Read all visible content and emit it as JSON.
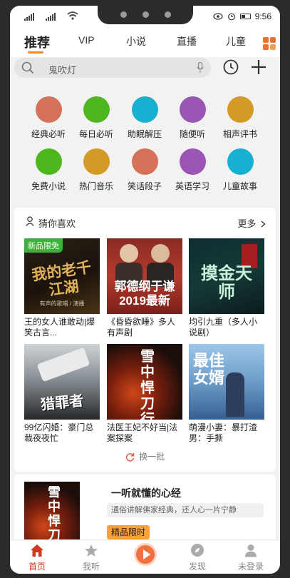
{
  "status": {
    "time": "9:56"
  },
  "tabs": [
    {
      "label": "推荐"
    },
    {
      "label": "VIP"
    },
    {
      "label": "小说"
    },
    {
      "label": "直播"
    },
    {
      "label": "儿童"
    }
  ],
  "search": {
    "placeholder": "鬼吹灯"
  },
  "categories": [
    {
      "label": "经典必听",
      "color": "#d6725a"
    },
    {
      "label": "每日必听",
      "color": "#4db81e"
    },
    {
      "label": "助眠解压",
      "color": "#17b0d0"
    },
    {
      "label": "随便听",
      "color": "#9a55b5"
    },
    {
      "label": "相声评书",
      "color": "#d49a25"
    },
    {
      "label": "免费小说",
      "color": "#4db81e"
    },
    {
      "label": "热门音乐",
      "color": "#d49a25"
    },
    {
      "label": "笑话段子",
      "color": "#d6725a"
    },
    {
      "label": "英语学习",
      "color": "#9a55b5"
    },
    {
      "label": "儿童故事",
      "color": "#17b0d0"
    }
  ],
  "recommend": {
    "title": "猜你喜欢",
    "more": "更多",
    "refresh": "换一批",
    "books": [
      {
        "title": "王的女人谁敢动|爆笑古言...",
        "badge": "新品限免",
        "cover_text": "我的老千江湖",
        "cover_subtext": "有声的歌唱 / 演播"
      },
      {
        "title": "《昏昏欲睡》多人有声剧",
        "cover_text": "郭德纲于谦 2019最新"
      },
      {
        "title": "均引九重（多人小说剧）",
        "cover_text": "摸金天师"
      },
      {
        "title": "99亿闪婚：豪门总裁夜夜忙",
        "cover_text": "猎罪者"
      },
      {
        "title": "法医王妃不好当|法案探案",
        "cover_text": "雪中悍刀行"
      },
      {
        "title": "萌漫小妻：暴打渣男：手撕",
        "cover_text": "最佳女婿"
      }
    ]
  },
  "feature": {
    "title": "一听就懂的心经",
    "desc": "通俗讲解佛家经典，还人心一片宁静",
    "tag": "精品限时",
    "cover_text": "雪中悍刀行"
  },
  "bottom_nav": [
    {
      "label": "首页"
    },
    {
      "label": "我听"
    },
    {
      "label": "发现"
    },
    {
      "label": "未登录"
    }
  ],
  "colors": {
    "accent": "#f08a24",
    "nav_active": "#d0391f",
    "play": "#f37040"
  }
}
